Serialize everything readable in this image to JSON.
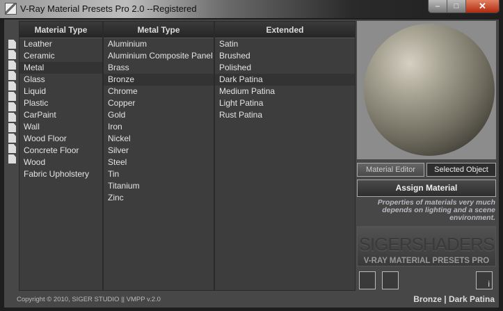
{
  "window": {
    "title": "V-Ray Material Presets Pro 2.0 --Registered",
    "minimize": "–",
    "maximize": "□",
    "close": "✕"
  },
  "columns": {
    "material_type": {
      "header": "Material Type",
      "items": [
        "Leather",
        "Ceramic",
        "Metal",
        "Glass",
        "Liquid",
        "Plastic",
        "CarPaint",
        "Wall",
        "Wood Floor",
        "Concrete Floor",
        "Wood",
        "Fabric Upholstery"
      ],
      "selected": "Metal"
    },
    "metal_type": {
      "header": "Metal Type",
      "items": [
        "Aluminium",
        "Aluminium Composite Panel",
        "Brass",
        "Bronze",
        "Chrome",
        "Copper",
        "Gold",
        "Iron",
        "Nickel",
        "Silver",
        "Steel",
        "Tin",
        "Titanium",
        "Zinc"
      ],
      "selected": "Bronze"
    },
    "extended": {
      "header": "Extended",
      "items": [
        "Satin",
        "Brushed",
        "Polished",
        "Dark Patina",
        "Medium Patina",
        "Light Patina",
        "Rust Patina"
      ],
      "selected": "Dark Patina"
    }
  },
  "panel": {
    "material_editor": "Material Editor",
    "selected_object": "Selected Object",
    "assign": "Assign Material",
    "note": "Properties of materials very much depends on lighting and a scene environment.",
    "logo": "SIGERSHADERS",
    "logo_sub": "V-RAY MATERIAL PRESETS PRO",
    "info": "i"
  },
  "footer": {
    "copyright": "Copyright © 2010, SIGER STUDIO || VMPP v.2.0",
    "status": "Bronze | Dark Patina"
  }
}
